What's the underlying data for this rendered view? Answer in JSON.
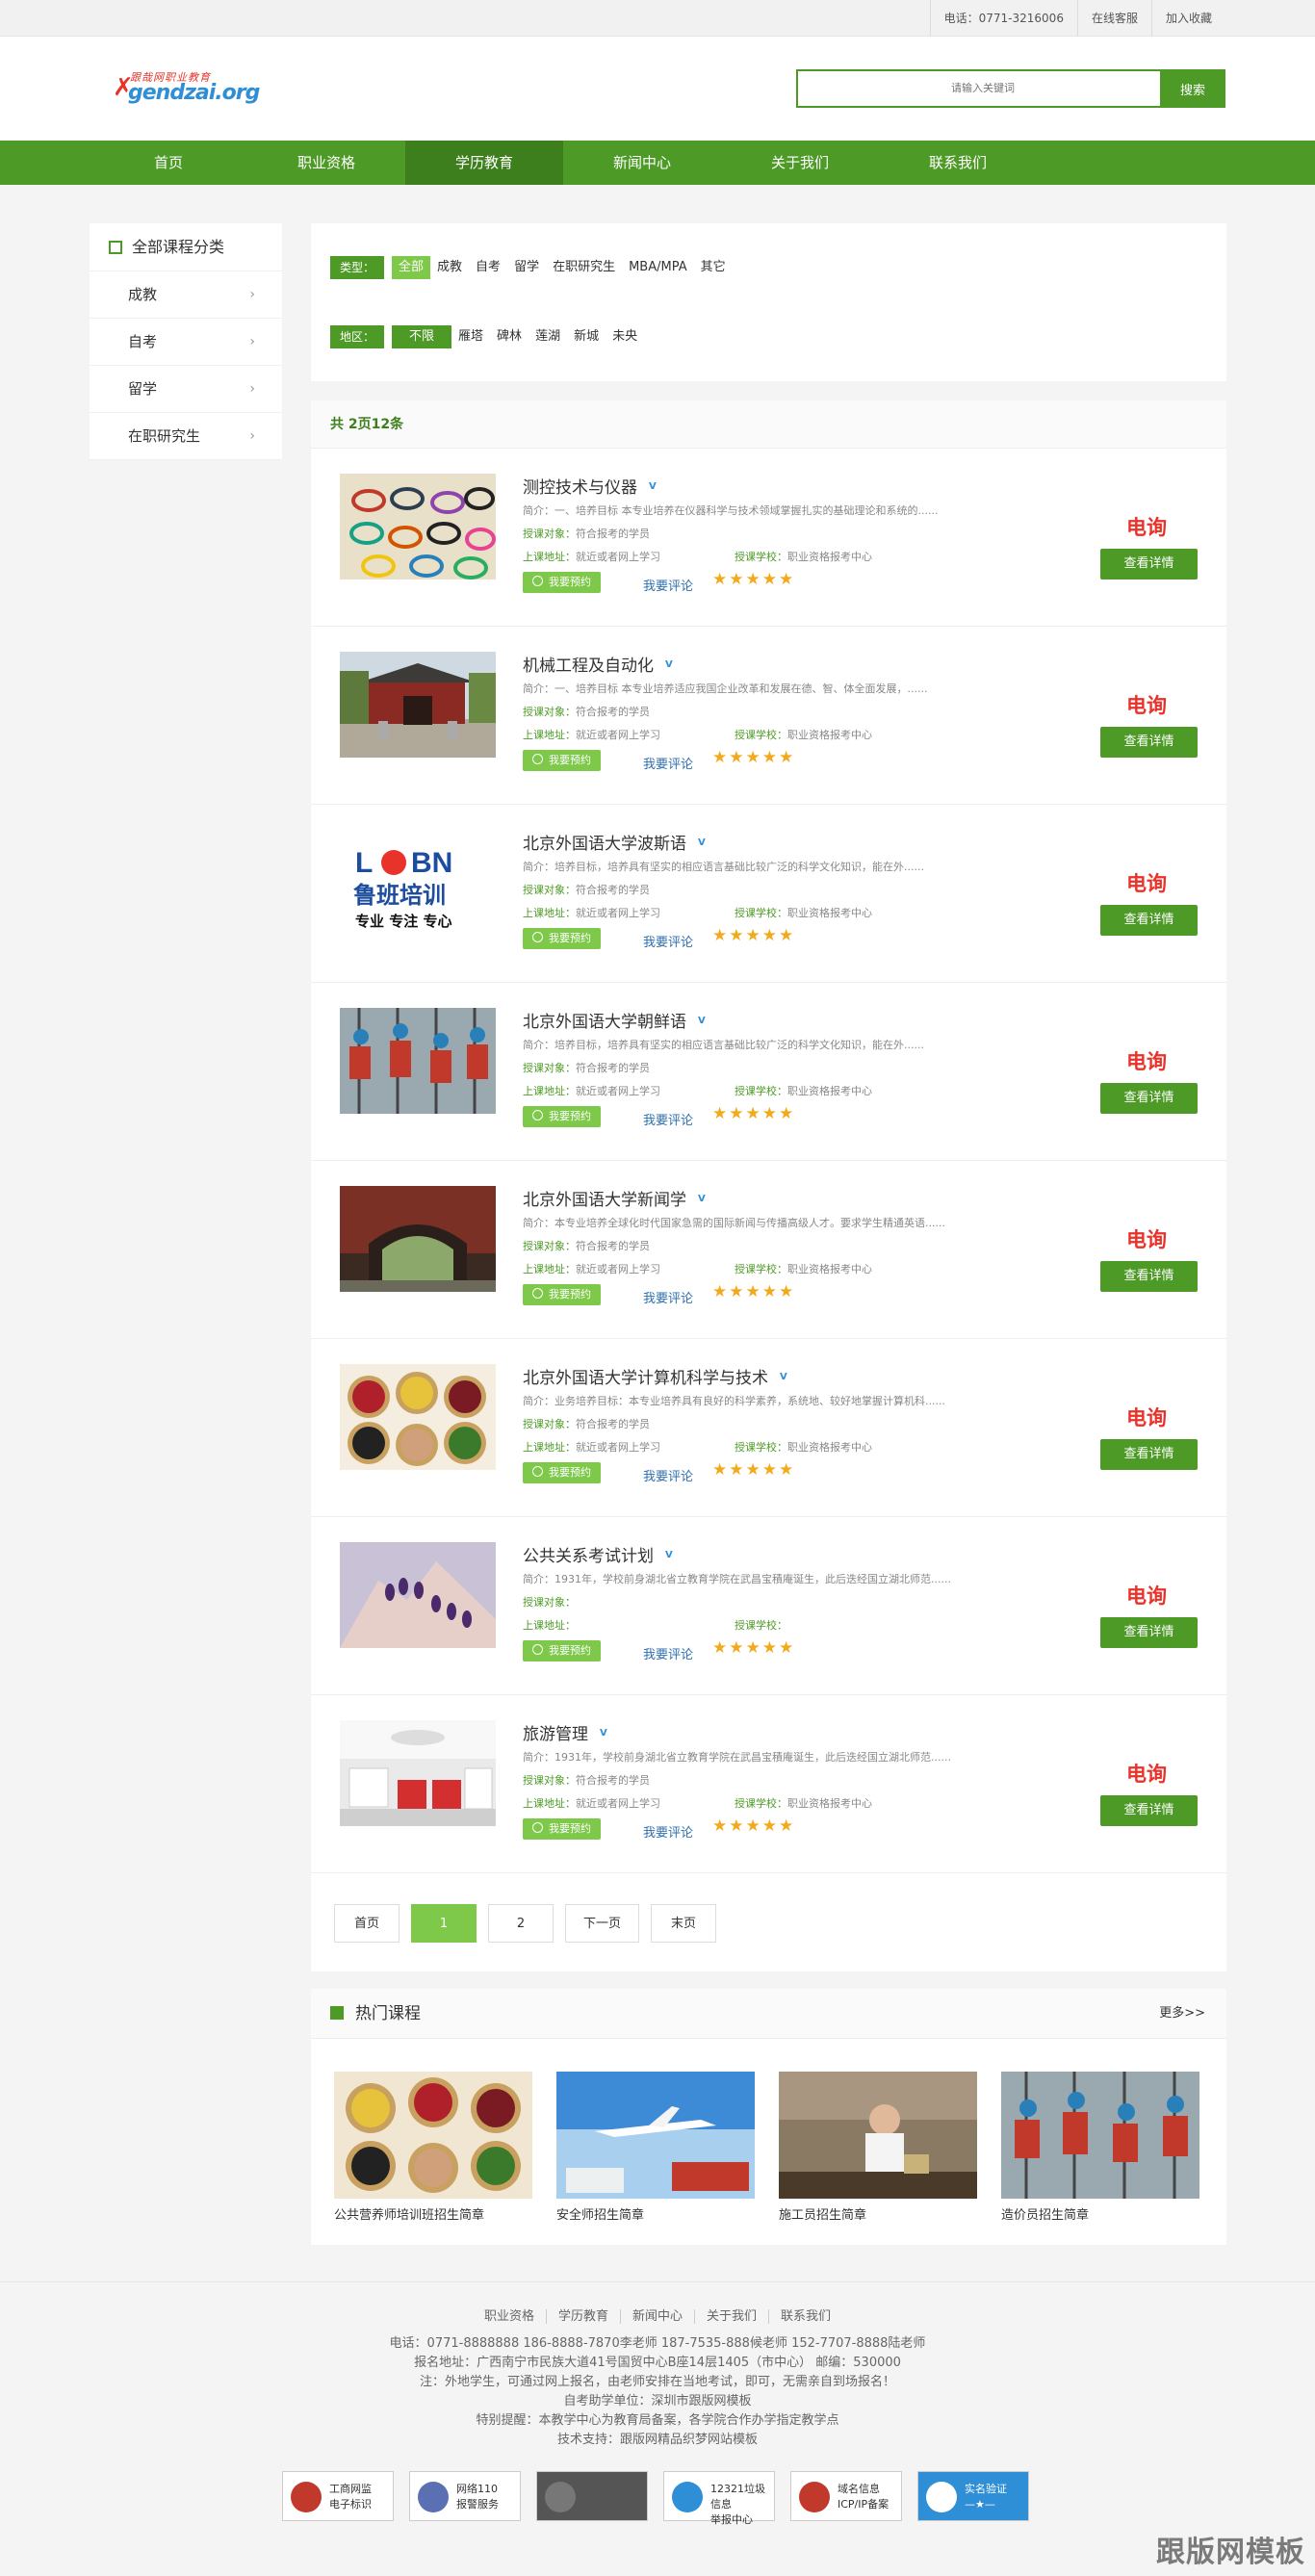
{
  "topbar": {
    "phone": "电话：0771-3216006",
    "service": "在线客服",
    "favorite": "加入收藏"
  },
  "logo": {
    "line1": "跟哉网职业教育",
    "line2": "gendzai.org"
  },
  "search": {
    "placeholder": "请输入关键词",
    "button": "搜索"
  },
  "nav": [
    "首页",
    "职业资格",
    "学历教育",
    "新闻中心",
    "关于我们",
    "联系我们"
  ],
  "nav_active": "学历教育",
  "sidebar": {
    "title": "全部课程分类",
    "items": [
      "成教",
      "自考",
      "留学",
      "在职研究生"
    ]
  },
  "filter": {
    "type_label": "类型：",
    "types": [
      "全部",
      "成教",
      "自考",
      "留学",
      "在职研究生",
      "MBA/MPA",
      "其它"
    ],
    "area_label": "地区：",
    "areas": [
      "不限",
      "雁塔",
      "碑林",
      "莲湖",
      "新城",
      "未央"
    ]
  },
  "list_summary": "共 2页12条",
  "courses": [
    {
      "title": "测控技术与仪器",
      "v": "V",
      "desc": "简介：一、培养目标 本专业培养在仪器科学与技术领域掌握扎实的基础理论和系统的......",
      "obj_label": "授课对象：",
      "obj": "符合报考的学员",
      "addr_label": "上课地址：",
      "addr": "就近或者网上学习",
      "sch_label": "授课学校：",
      "sch": "职业资格报考中心",
      "book": "我要预约",
      "comment": "我要评论",
      "stars": "★★★★★",
      "price": "电询",
      "detail": "查看详情"
    },
    {
      "title": "机械工程及自动化",
      "v": "V",
      "desc": "简介：一、培养目标 本专业培养适应我国企业改革和发展在德、智、体全面发展，......",
      "obj_label": "授课对象：",
      "obj": "符合报考的学员",
      "addr_label": "上课地址：",
      "addr": "就近或者网上学习",
      "sch_label": "授课学校：",
      "sch": "职业资格报考中心",
      "book": "我要预约",
      "comment": "我要评论",
      "stars": "★★★★★",
      "price": "电询",
      "detail": "查看详情"
    },
    {
      "title": "北京外国语大学波斯语",
      "v": "V",
      "desc": "简介：培养目标，培养具有坚实的相应语言基础比较广泛的科学文化知识，能在外......",
      "obj_label": "授课对象：",
      "obj": "符合报考的学员",
      "addr_label": "上课地址：",
      "addr": "就近或者网上学习",
      "sch_label": "授课学校：",
      "sch": "职业资格报考中心",
      "book": "我要预约",
      "comment": "我要评论",
      "stars": "★★★★★",
      "price": "电询",
      "detail": "查看详情"
    },
    {
      "title": "北京外国语大学朝鲜语",
      "v": "V",
      "desc": "简介：培养目标，培养具有坚实的相应语言基础比较广泛的科学文化知识，能在外......",
      "obj_label": "授课对象：",
      "obj": "符合报考的学员",
      "addr_label": "上课地址：",
      "addr": "就近或者网上学习",
      "sch_label": "授课学校：",
      "sch": "职业资格报考中心",
      "book": "我要预约",
      "comment": "我要评论",
      "stars": "★★★★★",
      "price": "电询",
      "detail": "查看详情"
    },
    {
      "title": "北京外国语大学新闻学",
      "v": "V",
      "desc": "简介：本专业培养全球化时代国家急需的国际新闻与传播高级人才。要求学生精通英语......",
      "obj_label": "授课对象：",
      "obj": "符合报考的学员",
      "addr_label": "上课地址：",
      "addr": "就近或者网上学习",
      "sch_label": "授课学校：",
      "sch": "职业资格报考中心",
      "book": "我要预约",
      "comment": "我要评论",
      "stars": "★★★★★",
      "price": "电询",
      "detail": "查看详情"
    },
    {
      "title": "北京外国语大学计算机科学与技术",
      "v": "V",
      "desc": "简介：业务培养目标：本专业培养具有良好的科学素养，系统地、较好地掌握计算机科......",
      "obj_label": "授课对象：",
      "obj": "符合报考的学员",
      "addr_label": "上课地址：",
      "addr": "就近或者网上学习",
      "sch_label": "授课学校：",
      "sch": "职业资格报考中心",
      "book": "我要预约",
      "comment": "我要评论",
      "stars": "★★★★★",
      "price": "电询",
      "detail": "查看详情"
    },
    {
      "title": "公共关系考试计划",
      "v": "V",
      "desc": "简介：1931年，学校前身湖北省立教育学院在武昌宝積庵诞生，此后迭经国立湖北师范......",
      "obj_label": "授课对象：",
      "obj": "",
      "addr_label": "上课地址：",
      "addr": "",
      "sch_label": "授课学校：",
      "sch": "",
      "book": "我要预约",
      "comment": "我要评论",
      "stars": "★★★★★",
      "price": "电询",
      "detail": "查看详情"
    },
    {
      "title": "旅游管理",
      "v": "V",
      "desc": "简介：1931年，学校前身湖北省立教育学院在武昌宝積庵诞生，此后迭经国立湖北师范......",
      "obj_label": "授课对象：",
      "obj": "符合报考的学员",
      "addr_label": "上课地址：",
      "addr": "就近或者网上学习",
      "sch_label": "授课学校：",
      "sch": "职业资格报考中心",
      "book": "我要预约",
      "comment": "我要评论",
      "stars": "★★★★★",
      "price": "电询",
      "detail": "查看详情"
    }
  ],
  "pager": [
    "首页",
    "1",
    "2",
    "下一页",
    "末页"
  ],
  "pager_current": "1",
  "hot": {
    "title": "热门课程",
    "more": "更多>>",
    "items": [
      "公共营养师培训班招生简章",
      "安全师招生简章",
      "施工员招生简章",
      "造价员招生简章"
    ]
  },
  "footer": {
    "links": [
      "职业资格",
      "学历教育",
      "新闻中心",
      "关于我们",
      "联系我们"
    ],
    "lines": [
      "电话：0771-8888888 186-8888-7870李老师 187-7535-888候老师 152-7707-8888陆老师",
      "报名地址：广西南宁市民族大道41号国贸中心B座14层1405（市中心） 邮编：530000",
      "注：外地学生，可通过网上报名，由老师安排在当地考试，即可，无需亲自到场报名！",
      "自考助学单位：深圳市跟版网模板",
      "特别提醒：本教学中心为教育局备案，各学院合作办学指定教学点",
      "技术支持：跟版网精品织梦网站模板"
    ],
    "badges": [
      {
        "t1": "工商网监",
        "t2": "电子标识"
      },
      {
        "t1": "网络110",
        "t2": "报警服务"
      },
      {
        "t1": "",
        "t2": ""
      },
      {
        "t1": "12321垃圾信息",
        "t2": "举报中心"
      },
      {
        "t1": "域名信息",
        "t2": "ICP/IP备案"
      },
      {
        "t1": "实名验证",
        "t2": "—★—"
      }
    ]
  },
  "watermark": "跟版网模板"
}
